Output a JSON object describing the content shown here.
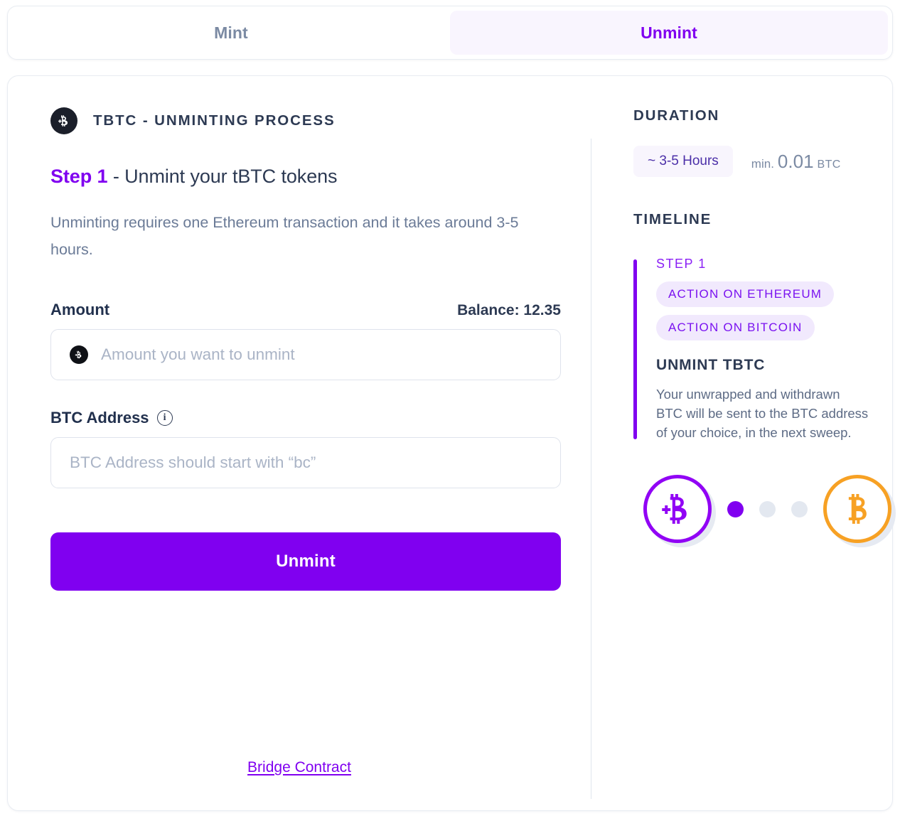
{
  "tabs": [
    {
      "label": "Mint",
      "active": false
    },
    {
      "label": "Unmint",
      "active": true
    }
  ],
  "process": {
    "icon": "tbtc-coin-icon",
    "title": "TBTC - UNMINTING PROCESS",
    "step_accent": "Step 1",
    "step_rest": " - Unmint your tBTC tokens",
    "description": "Unminting requires one Ethereum transaction and it takes around 3-5 hours."
  },
  "form": {
    "amount_label": "Amount",
    "balance_label": "Balance: 12.35",
    "amount_placeholder": "Amount you want to unmint",
    "amount_value": "",
    "address_label": "BTC Address",
    "address_info_icon": "info-icon",
    "address_placeholder": "BTC Address should start with “bc”",
    "address_value": "",
    "submit_label": "Unmint"
  },
  "footer": {
    "bridge_link": "Bridge Contract"
  },
  "duration": {
    "heading": "DURATION",
    "pill": "~ 3-5 Hours",
    "min_prefix": "min.",
    "min_value": "0.01",
    "min_currency": "BTC"
  },
  "timeline": {
    "heading": "TIMELINE",
    "step_label": "STEP 1",
    "badges": [
      "ACTION ON ETHEREUM",
      "ACTION ON BITCOIN"
    ],
    "title": "UNMINT TBTC",
    "body": "Your unwrapped and withdrawn BTC will be sent to the BTC address of your choice, in the next sweep."
  },
  "progress": {
    "from_icon": "tbtc-coin-icon",
    "to_icon": "bitcoin-coin-icon",
    "dots": [
      "on",
      "off",
      "off"
    ]
  },
  "colors": {
    "accent_purple": "#8000f0",
    "bitcoin_orange": "#f7a124",
    "text_dark": "#2d3a53",
    "text_muted": "#6b7b97",
    "pill_bg": "#f1e9fd",
    "tab_active_bg": "#f9f5fe"
  }
}
